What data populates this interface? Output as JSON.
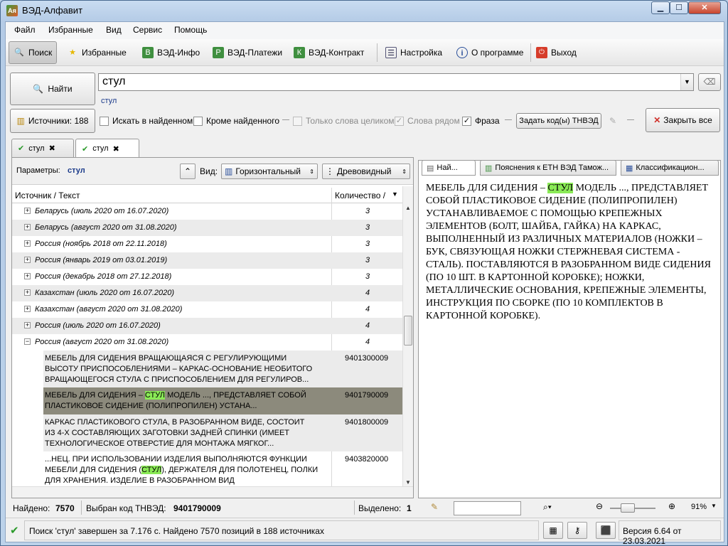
{
  "window": {
    "title": "ВЭД-Алфавит",
    "app_icon": "Ая"
  },
  "menu": [
    "Файл",
    "Избранные",
    "Вид",
    "Сервис",
    "Помощь"
  ],
  "toolbar": {
    "search": "Поиск",
    "favorites": "Избранные",
    "ved_info": "ВЭД-Инфо",
    "ved_payments": "ВЭД-Платежи",
    "ved_contract": "ВЭД-Контракт",
    "settings": "Настройка",
    "about": "О программе",
    "exit": "Выход"
  },
  "search": {
    "find_button": "Найти",
    "query": "стул",
    "hint": "стул"
  },
  "options": {
    "sources_button": "Источники: 188",
    "search_in_found": "Искать в найденном",
    "except_found": "Кроме найденного",
    "whole_words": "Только слова целиком",
    "words_nearby": "Слова рядом",
    "phrase": "Фраза",
    "set_codes": "Задать код(ы) ТНВЭД",
    "close_all": "Закрыть все"
  },
  "query_tabs": [
    {
      "label": "стул"
    },
    {
      "label": "стул"
    }
  ],
  "params": {
    "label": "Параметры:",
    "value": "стул",
    "view_label": "Вид:",
    "view_mode": "Горизонтальный",
    "tree_mode": "Древовидный"
  },
  "table": {
    "col_source": "Источник / Текст",
    "col_count": "Количество /",
    "groups": [
      {
        "name": "Беларусь (июль 2020 от 16.07.2020)",
        "count": "3"
      },
      {
        "name": "Беларусь (август 2020 от 31.08.2020)",
        "count": "3"
      },
      {
        "name": "Россия (ноябрь 2018 от 22.11.2018)",
        "count": "3"
      },
      {
        "name": "Россия (январь 2019 от 03.01.2019)",
        "count": "3"
      },
      {
        "name": "Россия (декабрь 2018 от 27.12.2018)",
        "count": "3"
      },
      {
        "name": "Казахстан (июль 2020 от 16.07.2020)",
        "count": "4"
      },
      {
        "name": "Казахстан (август 2020 от 31.08.2020)",
        "count": "4"
      },
      {
        "name": "Россия (июль 2020 от 16.07.2020)",
        "count": "4"
      },
      {
        "name": "Россия (август 2020 от 31.08.2020)",
        "count": "4"
      }
    ],
    "leaves": [
      {
        "l1": "МЕБЕЛЬ ДЛЯ СИДЕНИЯ ВРАЩАЮЩАЯСЯ С РЕГУЛИРУЮЩИМИ",
        "l2": "ВЫСОТУ ПРИСПОСОБЛЕНИЯМИ – КАРКАС-ОСНОВАНИЕ НЕОБИТОГО",
        "l3": "ВРАЩАЮЩЕГОСЯ СТУЛА С ПРИСПОСОБЛЕНИЕМ ДЛЯ РЕГУЛИРОВ...",
        "code": "9401300009"
      },
      {
        "l1a": "МЕБЕЛЬ ДЛЯ СИДЕНИЯ – ",
        "l1hl": "СТУЛ",
        "l1b": " МОДЕЛЬ ..., ПРЕДСТАВЛЯЕТ СОБОЙ",
        "l2": "ПЛАСТИКОВОЕ СИДЕНИЕ (ПОЛИПРОПИЛЕН) УСТАНА...",
        "code": "9401790009"
      },
      {
        "l1": "КАРКАС ПЛАСТИКОВОГО СТУЛА, В РАЗОБРАННОМ ВИДЕ, СОСТОИТ",
        "l2": "ИЗ 4-Х СОСТАВЛЯЮЩИХ ЗАГОТОВКИ ЗАДНЕЙ СПИНКИ (ИМЕЕТ",
        "l3": "ТЕХНОЛОГИЧЕСКОЕ ОТВЕРСТИЕ ДЛЯ МОНТАЖА МЯГКОГ...",
        "code": "9401800009"
      },
      {
        "l1": "...НЕЦ. ПРИ ИСПОЛЬЗОВАНИИ ИЗДЕЛИЯ ВЫПОЛНЯЮТСЯ ФУНКЦИИ",
        "l2a": "МЕБЕЛИ ДЛЯ СИДЕНИЯ (",
        "l2hl": "СТУЛ",
        "l2b": "), ДЕРЖАТЕЛЯ ДЛЯ ПОЛОТЕНЕЦ, ПОЛКИ",
        "l3": "ДЛЯ ХРАНЕНИЯ. ИЗДЕЛИЕ В РАЗОБРАННОМ ВИД",
        "code": "9403820000"
      }
    ]
  },
  "left_status": {
    "found_label": "Найдено:",
    "found_value": "7570",
    "code_label": "Выбран код ТНВЭД:",
    "code_value": "9401790009",
    "selected_label": "Выделено:",
    "selected_value": "1"
  },
  "right_tabs": [
    "Най...",
    "Пояснения к ЕТН ВЭД Тамож...",
    "Классификацион..."
  ],
  "detail": {
    "before": "МЕБЕЛЬ ДЛЯ СИДЕНИЯ – ",
    "highlight": "СТУЛ",
    "after": " МОДЕЛЬ ..., ПРЕДСТАВЛЯЕТ СОБОЙ ПЛАСТИКОВОЕ СИДЕНИЕ (ПОЛИПРОПИЛЕН) УСТАНАВЛИВАЕМОЕ С ПОМОЩЬЮ КРЕПЕЖНЫХ ЭЛЕМЕНТОВ (БОЛТ, ШАЙБА, ГАЙКА) НА КАРКАС, ВЫПОЛНЕННЫЙ ИЗ РАЗЛИЧНЫХ МАТЕРИАЛОВ (НОЖКИ – БУК, СВЯЗУЮЩАЯ НОЖКИ СТЕРЖНЕВАЯ СИСТЕМА - СТАЛЬ). ПОСТАВЛЯЮТСЯ В РАЗОБРАННОМ ВИДЕ СИДЕНИЯ (ПО 10 ШТ. В КАРТОННОЙ КОРОБКЕ); НОЖКИ, МЕТАЛЛИЧЕСКИЕ ОСНОВАНИЯ, КРЕПЕЖНЫЕ ЭЛЕМЕНТЫ, ИНСТРУКЦИЯ ПО СБОРКЕ (ПО 10 КОМПЛЕКТОВ В КАРТОННОЙ КОРОБКЕ)."
  },
  "zoom": {
    "value": "91%",
    "level": 0.35
  },
  "status": {
    "message": "Поиск 'стул' завершен за 7.176 с. Найдено 7570 позиций в 188 источниках",
    "version": "Версия 6.64 от 23.03.2021"
  },
  "colors": {
    "highlight": "#8aea56",
    "selected_row": "#8c8a7c"
  }
}
